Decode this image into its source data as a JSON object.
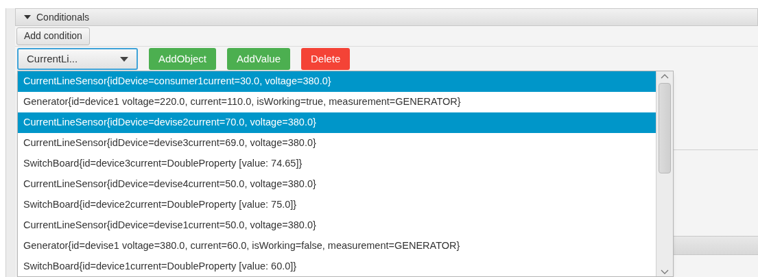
{
  "section": {
    "title": "Conditionals",
    "expanded": true
  },
  "add_condition_button": "Add condition",
  "combo": {
    "value": "CurrentLi..."
  },
  "buttons": [
    {
      "label": "AddObject",
      "kind": "add"
    },
    {
      "label": "AddValue",
      "kind": "add"
    },
    {
      "label": "Delete",
      "kind": "delete"
    }
  ],
  "dropdown_items": [
    {
      "label": "CurrentLineSensor{idDevice=consumer1current=30.0, voltage=380.0}",
      "selected": true
    },
    {
      "label": "Generator{id=device1 voltage=220.0, current=110.0, isWorking=true, measurement=GENERATOR}",
      "selected": false
    },
    {
      "label": "CurrentLineSensor{idDevice=devise2current=70.0, voltage=380.0}",
      "selected": true
    },
    {
      "label": "CurrentLineSensor{idDevice=devise3current=69.0, voltage=380.0}",
      "selected": false
    },
    {
      "label": "SwitchBoard{id=device3current=DoubleProperty [value: 74.65]}",
      "selected": false
    },
    {
      "label": "CurrentLineSensor{idDevice=devise4current=50.0, voltage=380.0}",
      "selected": false
    },
    {
      "label": "SwitchBoard{id=device2current=DoubleProperty [value: 75.0]}",
      "selected": false
    },
    {
      "label": "CurrentLineSensor{idDevice=devise1current=50.0, voltage=380.0}",
      "selected": false
    },
    {
      "label": "Generator{id=devise1 voltage=380.0, current=60.0, isWorking=false, measurement=GENERATOR}",
      "selected": false
    },
    {
      "label": "SwitchBoard{id=device1current=DoubleProperty [value: 60.0]}",
      "selected": false
    }
  ]
}
